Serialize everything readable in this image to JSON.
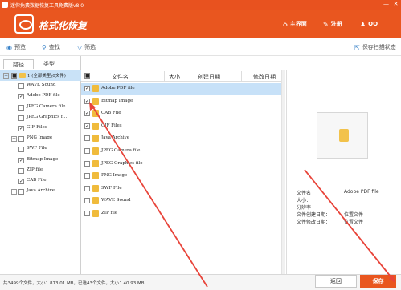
{
  "titlebar": {
    "title": "迷你免费数据恢复工具免费版v8.0",
    "minimize": "—",
    "close": "✕"
  },
  "header": {
    "mode_title": "格式化恢复",
    "nav": [
      {
        "icon": "home-icon",
        "label": "主界面"
      },
      {
        "icon": "register-icon",
        "label": "注册"
      },
      {
        "icon": "qq-icon",
        "label": "QQ"
      }
    ]
  },
  "toolbar": {
    "preview": "预览",
    "find": "查找",
    "filter": "筛选",
    "save_scan": "保存扫描状态"
  },
  "left_tabs": [
    "路径",
    "类型"
  ],
  "tree": {
    "root_label": "1 (全部类型\\0文件)",
    "items": [
      {
        "label": "WAVE Sound",
        "checked": false,
        "expandable": false
      },
      {
        "label": "Adobe PDF file",
        "checked": true,
        "expandable": false
      },
      {
        "label": "JPEG Camera file",
        "checked": false,
        "expandable": false
      },
      {
        "label": "JPEG Graphics f…",
        "checked": false,
        "expandable": false
      },
      {
        "label": "GIF Files",
        "checked": true,
        "expandable": false
      },
      {
        "label": "PNG Image",
        "checked": false,
        "expandable": true
      },
      {
        "label": "SWF File",
        "checked": false,
        "expandable": false
      },
      {
        "label": "Bitmap Image",
        "checked": true,
        "expandable": false
      },
      {
        "label": "ZIP file",
        "checked": false,
        "expandable": false
      },
      {
        "label": "CAB File",
        "checked": true,
        "expandable": false
      },
      {
        "label": "Java Archive",
        "checked": false,
        "expandable": true
      }
    ]
  },
  "list": {
    "columns": [
      "文件名",
      "大小",
      "创建日期",
      "修改日期"
    ],
    "rows": [
      {
        "name": "Adobe PDF file",
        "checked": true,
        "selected": true
      },
      {
        "name": "Bitmap Image",
        "checked": true,
        "selected": false
      },
      {
        "name": "CAB File",
        "checked": true,
        "selected": false
      },
      {
        "name": "GIF Files",
        "checked": true,
        "selected": false
      },
      {
        "name": "Java Archive",
        "checked": false,
        "selected": false
      },
      {
        "name": "JPEG Camera file",
        "checked": false,
        "selected": false
      },
      {
        "name": "JPEG Graphics file",
        "checked": false,
        "selected": false
      },
      {
        "name": "PNG Image",
        "checked": false,
        "selected": false
      },
      {
        "name": "SWF File",
        "checked": false,
        "selected": false
      },
      {
        "name": "WAVE Sound",
        "checked": false,
        "selected": false
      },
      {
        "name": "ZIP file",
        "checked": false,
        "selected": false
      }
    ]
  },
  "preview": {
    "props": [
      {
        "k": "文件名",
        "v": "Adobe PDF file"
      },
      {
        "k": "大小：",
        "v": ""
      },
      {
        "k": "分辨率",
        "v": ""
      },
      {
        "k": "文件创建日期：",
        "v": "位置文件"
      },
      {
        "k": "文件修改日期：",
        "v": "位置文件"
      }
    ]
  },
  "status": {
    "text": "共3499个文件，大小：873.01 MB，已选43个文件，大小：40.93 MB"
  },
  "buttons": {
    "back": "返回",
    "save": "保存"
  },
  "colors": {
    "brand": "#e9561f",
    "selection": "#c7e1f8",
    "arrow": "#e8443a"
  }
}
